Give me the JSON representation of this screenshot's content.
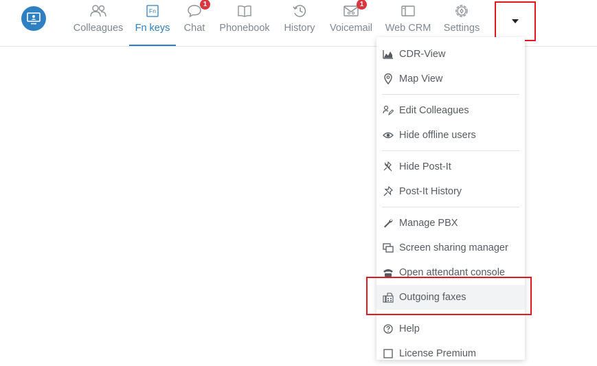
{
  "nav": {
    "tabs": [
      {
        "label": "Colleagues",
        "icon": "colleagues-icon"
      },
      {
        "label": "Fn keys",
        "icon": "fn-keys-icon",
        "icon_text": "Fn",
        "active": true
      },
      {
        "label": "Chat",
        "icon": "chat-icon",
        "badge": "1"
      },
      {
        "label": "Phonebook",
        "icon": "phonebook-icon"
      },
      {
        "label": "History",
        "icon": "history-icon"
      },
      {
        "label": "Voicemail",
        "icon": "voicemail-icon",
        "badge": "1"
      },
      {
        "label": "Web CRM",
        "icon": "web-crm-icon"
      },
      {
        "label": "Settings",
        "icon": "settings-icon"
      }
    ]
  },
  "menu": {
    "items": [
      {
        "label": "CDR-View",
        "icon": "chart-icon"
      },
      {
        "label": "Map View",
        "icon": "map-pin-icon"
      },
      {
        "label": "Edit Colleagues",
        "icon": "edit-users-icon"
      },
      {
        "label": "Hide offline users",
        "icon": "eye-icon"
      },
      {
        "label": "Hide Post-It",
        "icon": "pin-off-icon"
      },
      {
        "label": "Post-It History",
        "icon": "pin-icon"
      },
      {
        "label": "Manage PBX",
        "icon": "wrench-icon"
      },
      {
        "label": "Screen sharing manager",
        "icon": "screens-icon"
      },
      {
        "label": "Open attendant console",
        "icon": "phone-icon"
      },
      {
        "label": "Outgoing faxes",
        "icon": "fax-icon",
        "highlighted": true
      },
      {
        "label": "Help",
        "icon": "help-icon"
      },
      {
        "label": "License Premium",
        "icon": "license-icon"
      }
    ]
  },
  "colors": {
    "accent": "#2f80c2",
    "badge": "#d9373f",
    "annotation_red": "#e0191e"
  }
}
